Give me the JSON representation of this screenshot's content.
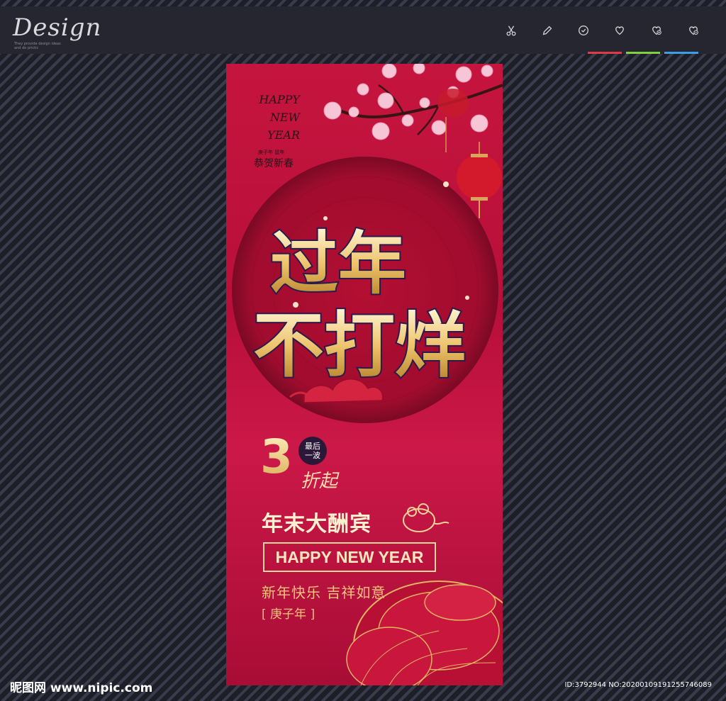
{
  "logo": {
    "text": "Design",
    "tagline": "They provide design ideas and do prictic"
  },
  "toolbar": {
    "tools": [
      {
        "name": "scissors-icon"
      },
      {
        "name": "pencil-icon"
      },
      {
        "name": "clock-icon"
      },
      {
        "name": "heart-icon"
      },
      {
        "name": "heart-add-icon"
      },
      {
        "name": "heart-remove-icon"
      }
    ],
    "underline_colors": [
      "#e03a46",
      "#7ed33c",
      "#3a9ee8"
    ]
  },
  "poster": {
    "happy_lines": [
      "HAPPY",
      "NEW",
      "YEAR"
    ],
    "small_label": "庚子年 鼠年",
    "small_greeting": "恭贺新春",
    "title_line1": "过年",
    "title_line2": "不打烊",
    "discount_number": "3",
    "badge_line1": "最后",
    "badge_line2": "一波",
    "discount_suffix": "折起",
    "headline": "年末大酬宾",
    "hny": "HAPPY NEW YEAR",
    "blessing": "新年快乐 吉祥如意",
    "year_label": "[ 庚子年 ]"
  },
  "watermark": {
    "site": "昵图网 www.nipic.com",
    "id": "ID:3792944 NO:20200109191255746089"
  }
}
